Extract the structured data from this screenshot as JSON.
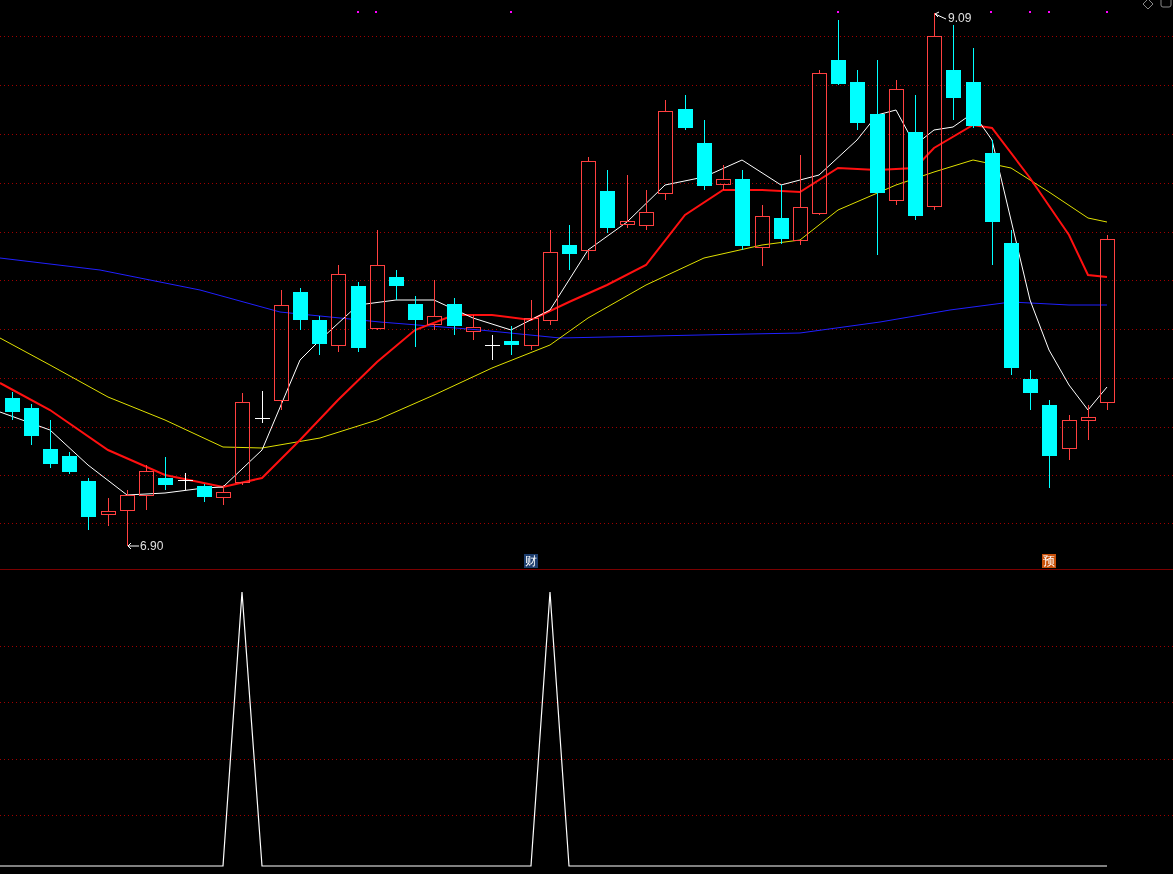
{
  "price_chart": {
    "high_label": "9.09",
    "low_label": "6.90"
  },
  "event_markers": [
    {
      "text": "财",
      "color": "#1c3d6e"
    },
    {
      "text": "预",
      "color": "#c8500a"
    }
  ]
}
